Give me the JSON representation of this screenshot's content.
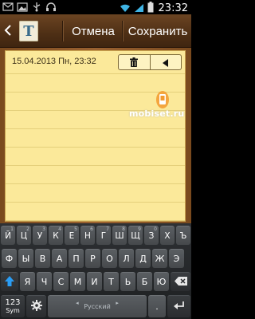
{
  "status_bar": {
    "time": "23:32",
    "left_icons": [
      "sms-icon",
      "image-icon",
      "usb-icon",
      "headset-icon"
    ],
    "right_icons": [
      "wifi-icon",
      "signal-icon",
      "battery-icon"
    ]
  },
  "action_bar": {
    "app_icon_letter": "T",
    "cancel_label": "Отмена",
    "save_label": "Сохранить"
  },
  "note": {
    "date": "15.04.2013 Пн, 23:32",
    "tools": [
      "trash-icon",
      "collapse-arrow-icon"
    ],
    "watermark": "mobiset.ru"
  },
  "keyboard": {
    "row1": [
      {
        "k": "Й",
        "s": "1"
      },
      {
        "k": "Ц",
        "s": "2"
      },
      {
        "k": "У",
        "s": "3"
      },
      {
        "k": "К",
        "s": "4"
      },
      {
        "k": "Е",
        "s": "5"
      },
      {
        "k": "Н",
        "s": "6"
      },
      {
        "k": "Г",
        "s": "7"
      },
      {
        "k": "Ш",
        "s": "8"
      },
      {
        "k": "Щ",
        "s": "9"
      },
      {
        "k": "З",
        "s": "0"
      },
      {
        "k": "Х",
        "s": ""
      },
      {
        "k": "Ъ",
        "s": ""
      }
    ],
    "row2": [
      "Ф",
      "Ы",
      "В",
      "А",
      "П",
      "Р",
      "О",
      "Л",
      "Д",
      "Ж",
      "Э"
    ],
    "row3": [
      "Я",
      "Ч",
      "С",
      "М",
      "И",
      "Т",
      "Ь",
      "Б",
      "Ю"
    ],
    "sym_top": "123",
    "sym_bottom": "Sym",
    "space_label": "Русский",
    "dot": "."
  },
  "colors": {
    "accent_shift": "#2a9df4",
    "paper": "#fbe99a",
    "wood": "#5a3516"
  }
}
